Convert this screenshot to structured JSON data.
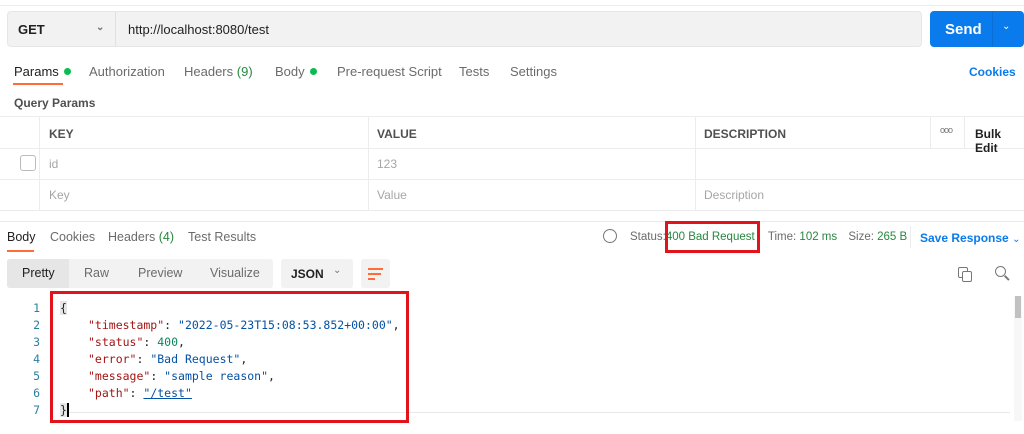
{
  "request": {
    "method": "GET",
    "url": "http://localhost:8080/test",
    "send_label": "Send"
  },
  "request_tabs": [
    {
      "label": "Params"
    },
    {
      "label": "Authorization"
    },
    {
      "label": "Headers",
      "count": "(9)"
    },
    {
      "label": "Body"
    },
    {
      "label": "Pre-request Script"
    },
    {
      "label": "Tests"
    },
    {
      "label": "Settings"
    }
  ],
  "cookies_link": "Cookies",
  "query_params": {
    "title": "Query Params",
    "headers": {
      "key": "KEY",
      "value": "VALUE",
      "description": "DESCRIPTION",
      "bulk_edit": "Bulk Edit",
      "more": "ooo"
    },
    "rows": [
      {
        "key": "id",
        "value": "123",
        "description": ""
      }
    ],
    "placeholders": {
      "key": "Key",
      "value": "Value",
      "description": "Description"
    }
  },
  "response_tabs": [
    {
      "label": "Body"
    },
    {
      "label": "Cookies"
    },
    {
      "label": "Headers",
      "count": "(4)"
    },
    {
      "label": "Test Results"
    }
  ],
  "response_meta": {
    "status_label": "Status:",
    "status": "400 Bad Request",
    "time_label": "Time:",
    "time": "102 ms",
    "size_label": "Size:",
    "size": "265 B",
    "save_label": "Save Response"
  },
  "view_modes": [
    "Pretty",
    "Raw",
    "Preview",
    "Visualize"
  ],
  "format": "JSON",
  "code": {
    "line_numbers": [
      "1",
      "2",
      "3",
      "4",
      "5",
      "6",
      "7"
    ],
    "open": "{",
    "close": "}",
    "fields": [
      {
        "key": "\"timestamp\"",
        "value": "\"2022-05-23T15:08:53.852+00:00\"",
        "comma": ","
      },
      {
        "key": "\"status\"",
        "value": "400",
        "comma": ","
      },
      {
        "key": "\"error\"",
        "value": "\"Bad Request\"",
        "comma": ","
      },
      {
        "key": "\"message\"",
        "value": "\"sample reason\"",
        "comma": ","
      },
      {
        "key": "\"path\"",
        "value": "\"/test\"",
        "comma": ""
      }
    ]
  },
  "colors": {
    "accent": "#097bed",
    "tab_underline": "#ff6c37",
    "success": "#0cbb52",
    "highlight_box": "#e3131b"
  }
}
